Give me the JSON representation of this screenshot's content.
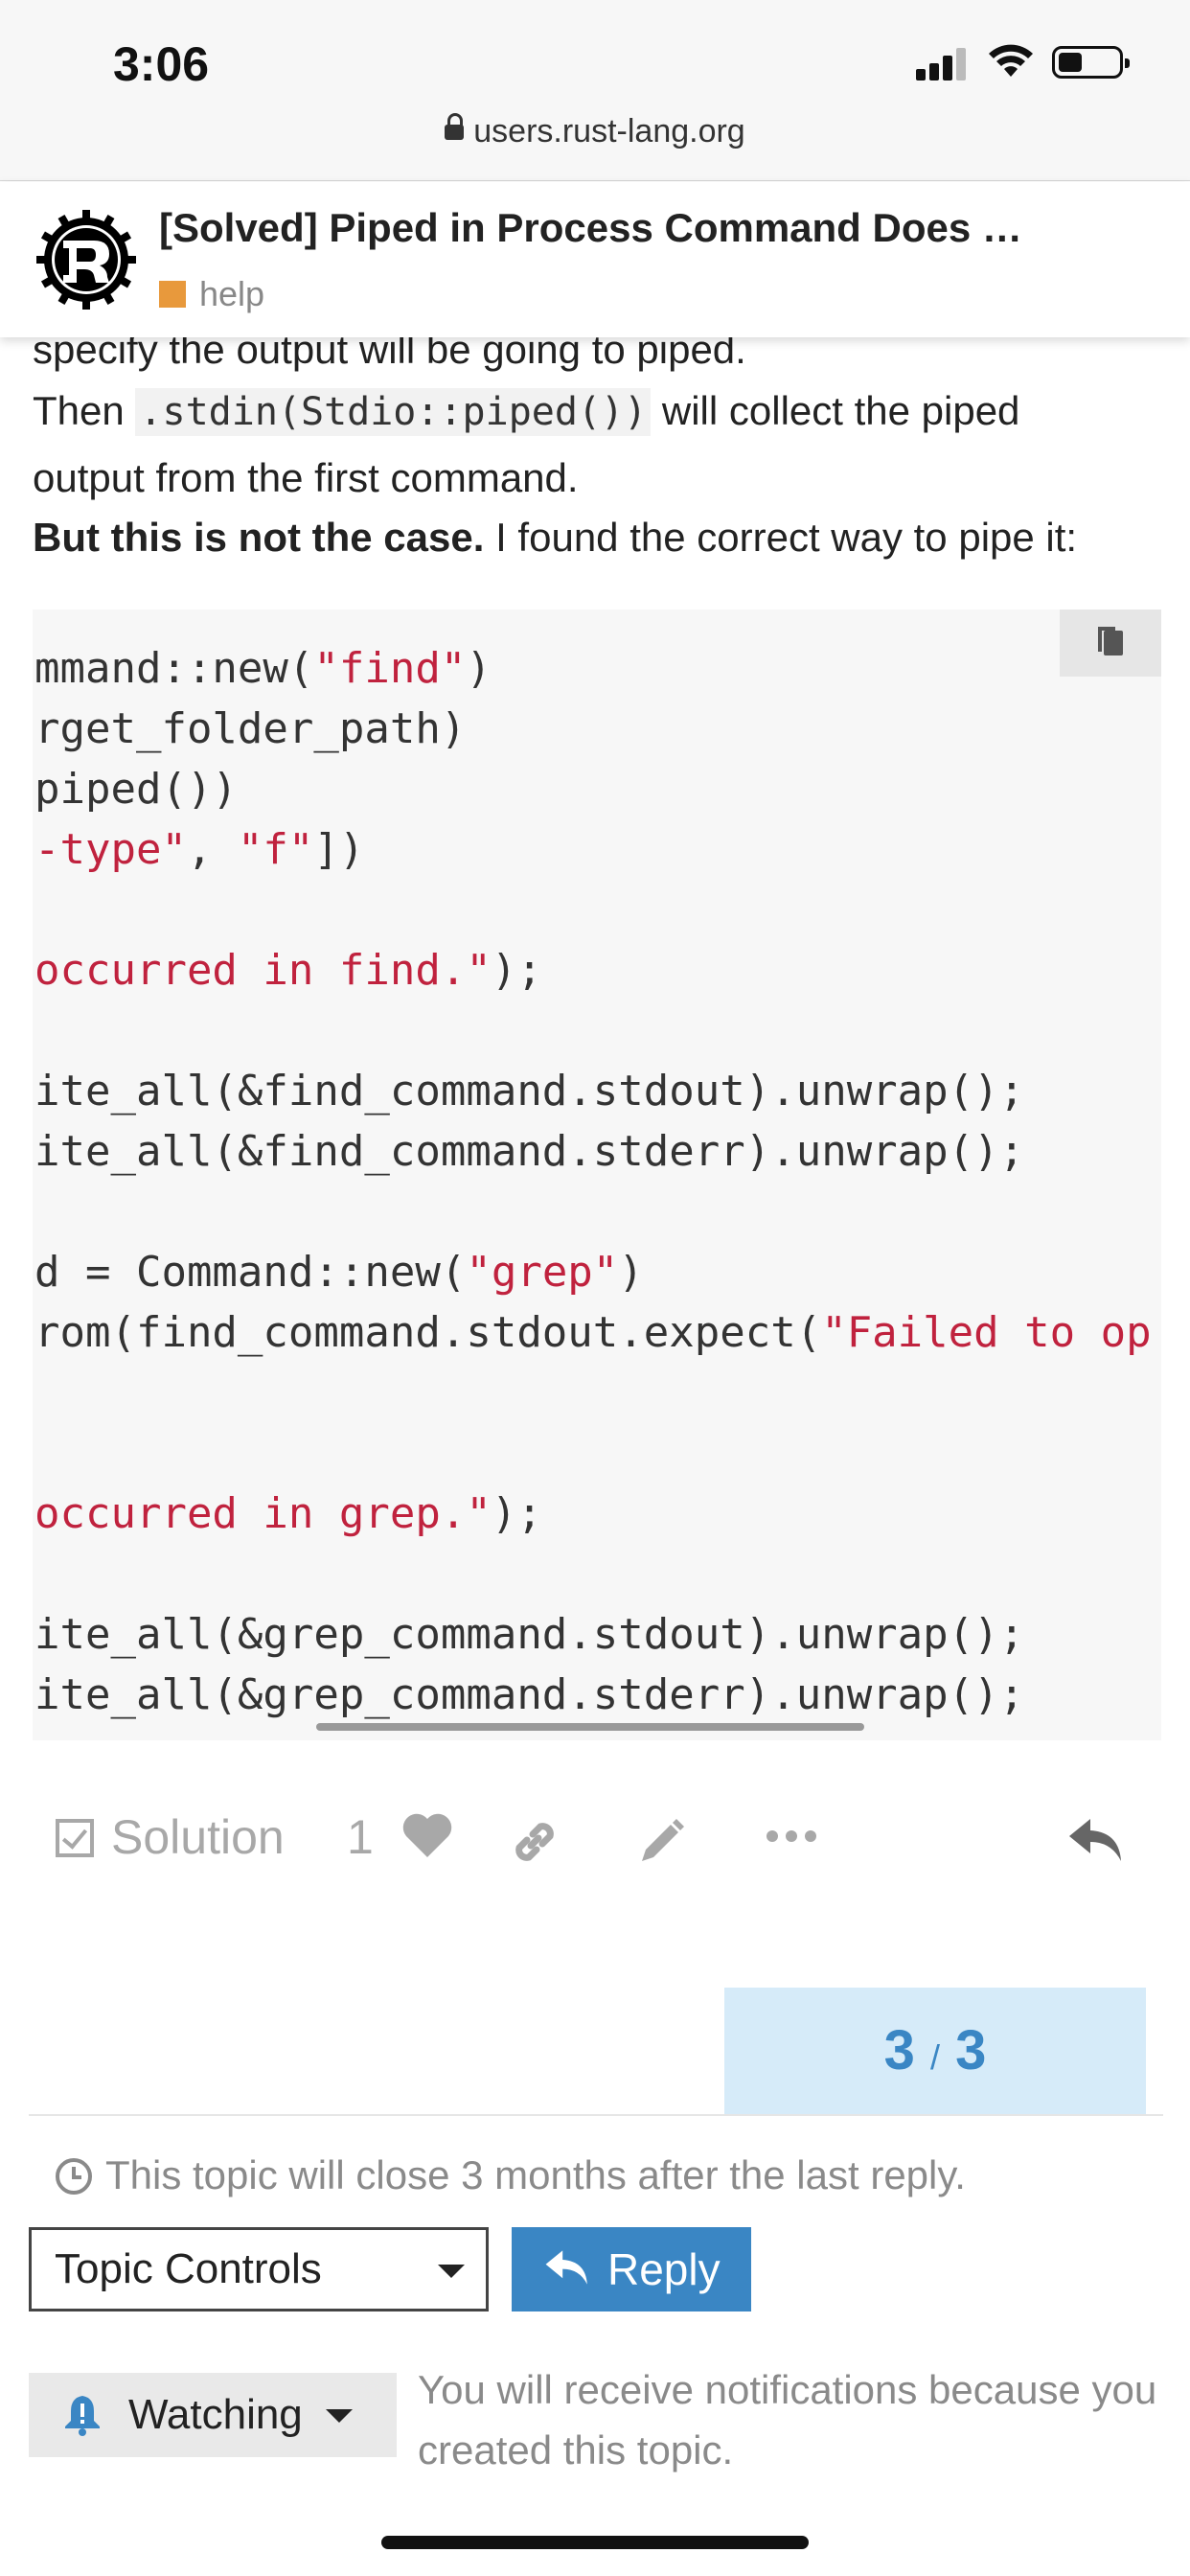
{
  "status_bar": {
    "time": "3:06"
  },
  "browser": {
    "url": "users.rust-lang.org"
  },
  "topic": {
    "title": "[Solved] Piped in Process Command Does …",
    "category": "help",
    "category_color": "#e8993c"
  },
  "post": {
    "line1": "specify the output will be going to piped.",
    "line2_pre": "Then ",
    "line2_code": ".stdin(Stdio::piped())",
    "line2_post": " will collect the piped",
    "line3": "output from the first command.",
    "line4_bold": "But this is not the case.",
    "line4_rest": " I found the correct way to pipe it:"
  },
  "code_lines": [
    [
      {
        "t": "mmand::new("
      },
      {
        "t": "\"find\"",
        "s": true
      },
      {
        "t": ")"
      }
    ],
    [
      {
        "t": "rget_folder_path)"
      }
    ],
    [
      {
        "t": "piped())"
      }
    ],
    [
      {
        "t": "-type\"",
        "s": true
      },
      {
        "t": ", "
      },
      {
        "t": "\"f\"",
        "s": true
      },
      {
        "t": "])"
      }
    ],
    [],
    [
      {
        "t": "occurred in find.\"",
        "s": true
      },
      {
        "t": ");"
      }
    ],
    [],
    [
      {
        "t": "ite_all(&find_command.stdout).unwrap();"
      }
    ],
    [
      {
        "t": "ite_all(&find_command.stderr).unwrap();"
      }
    ],
    [],
    [
      {
        "t": "d = Command::new("
      },
      {
        "t": "\"grep\"",
        "s": true
      },
      {
        "t": ")"
      }
    ],
    [
      {
        "t": "rom(find_command.stdout.expect("
      },
      {
        "t": "\"Failed to op",
        "s": true
      }
    ],
    [],
    [],
    [
      {
        "t": "occurred in grep.\"",
        "s": true
      },
      {
        "t": ");"
      }
    ],
    [],
    [
      {
        "t": "ite_all(&grep_command.stdout).unwrap();"
      }
    ],
    [
      {
        "t": "ite_all(&grep_command.stderr).unwrap();"
      }
    ]
  ],
  "actions": {
    "solution_label": "Solution",
    "like_count": "1"
  },
  "progress": {
    "current": "3",
    "separator": "/",
    "total": "3"
  },
  "close_note": "This topic will close 3 months after the last reply.",
  "controls": {
    "topic_controls_label": "Topic Controls",
    "reply_label": "Reply"
  },
  "notifications": {
    "watching_label": "Watching",
    "reason": "You will receive notifications because you created this topic."
  },
  "colors": {
    "accent": "#3a86c4",
    "progress_bg": "#d6ebf9",
    "string": "#c0223e",
    "muted": "#a8a8a8"
  }
}
